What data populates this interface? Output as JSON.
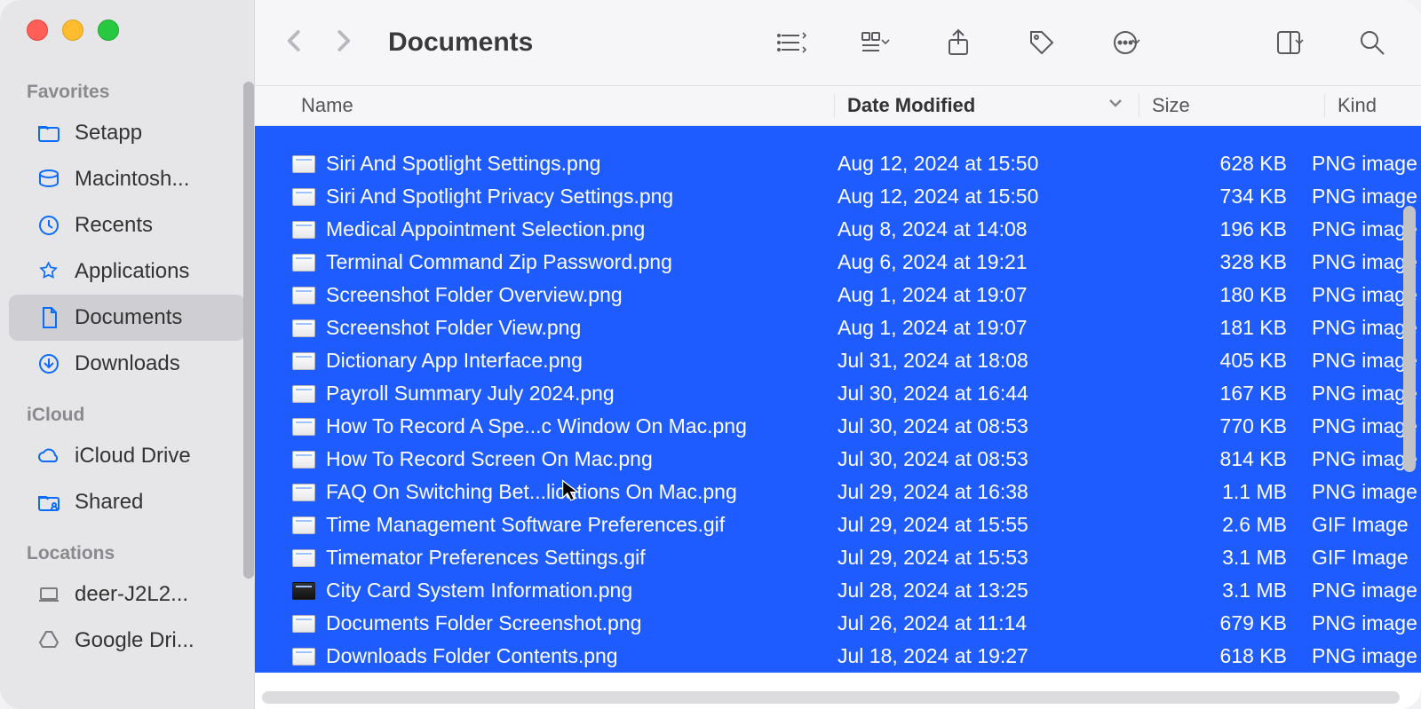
{
  "title": "Documents",
  "sidebar": {
    "groups": [
      {
        "label": "Favorites",
        "items": [
          {
            "icon": "folder",
            "label": "Setapp"
          },
          {
            "icon": "disk",
            "label": "Macintosh..."
          },
          {
            "icon": "clock",
            "label": "Recents"
          },
          {
            "icon": "app",
            "label": "Applications"
          },
          {
            "icon": "doc",
            "label": "Documents",
            "active": true
          },
          {
            "icon": "download",
            "label": "Downloads"
          }
        ]
      },
      {
        "label": "iCloud",
        "items": [
          {
            "icon": "cloud",
            "label": "iCloud Drive"
          },
          {
            "icon": "shared",
            "label": "Shared"
          }
        ]
      },
      {
        "label": "Locations",
        "items": [
          {
            "icon": "laptop",
            "label": "deer-J2L2...",
            "gray": true
          },
          {
            "icon": "gdrive",
            "label": "Google Dri...",
            "gray": true
          }
        ]
      }
    ]
  },
  "columns": {
    "name": "Name",
    "date": "Date Modified",
    "size": "Size",
    "kind": "Kind"
  },
  "files": [
    {
      "name": "Siri And Spotlight Settings.png",
      "date": "Aug 12, 2024 at 15:50",
      "size": "628 KB",
      "kind": "PNG image"
    },
    {
      "name": "Siri And Spotlight Privacy Settings.png",
      "date": "Aug 12, 2024 at 15:50",
      "size": "734 KB",
      "kind": "PNG image"
    },
    {
      "name": "Medical Appointment Selection.png",
      "date": "Aug 8, 2024 at 14:08",
      "size": "196 KB",
      "kind": "PNG image"
    },
    {
      "name": "Terminal Command Zip Password.png",
      "date": "Aug 6, 2024 at 19:21",
      "size": "328 KB",
      "kind": "PNG image"
    },
    {
      "name": "Screenshot Folder Overview.png",
      "date": "Aug 1, 2024 at 19:07",
      "size": "180 KB",
      "kind": "PNG image"
    },
    {
      "name": "Screenshot Folder View.png",
      "date": "Aug 1, 2024 at 19:07",
      "size": "181 KB",
      "kind": "PNG image"
    },
    {
      "name": "Dictionary App Interface.png",
      "date": "Jul 31, 2024 at 18:08",
      "size": "405 KB",
      "kind": "PNG image"
    },
    {
      "name": "Payroll Summary July 2024.png",
      "date": "Jul 30, 2024 at 16:44",
      "size": "167 KB",
      "kind": "PNG image"
    },
    {
      "name": "How To Record A Spe...c Window On Mac.png",
      "date": "Jul 30, 2024 at 08:53",
      "size": "770 KB",
      "kind": "PNG image"
    },
    {
      "name": "How To Record Screen On Mac.png",
      "date": "Jul 30, 2024 at 08:53",
      "size": "814 KB",
      "kind": "PNG image"
    },
    {
      "name": "FAQ On Switching Bet...lications On Mac.png",
      "date": "Jul 29, 2024 at 16:38",
      "size": "1.1 MB",
      "kind": "PNG image"
    },
    {
      "name": "Time Management Software Preferences.gif",
      "date": "Jul 29, 2024 at 15:55",
      "size": "2.6 MB",
      "kind": "GIF Image"
    },
    {
      "name": "Timemator Preferences Settings.gif",
      "date": "Jul 29, 2024 at 15:53",
      "size": "3.1 MB",
      "kind": "GIF Image"
    },
    {
      "name": "City Card System Information.png",
      "date": "Jul 28, 2024 at 13:25",
      "size": "3.1 MB",
      "kind": "PNG image",
      "dark": true
    },
    {
      "name": "Documents Folder Screenshot.png",
      "date": "Jul 26, 2024 at 11:14",
      "size": "679 KB",
      "kind": "PNG image"
    },
    {
      "name": "Downloads Folder Contents.png",
      "date": "Jul 18, 2024 at 19:27",
      "size": "618 KB",
      "kind": "PNG image"
    }
  ]
}
